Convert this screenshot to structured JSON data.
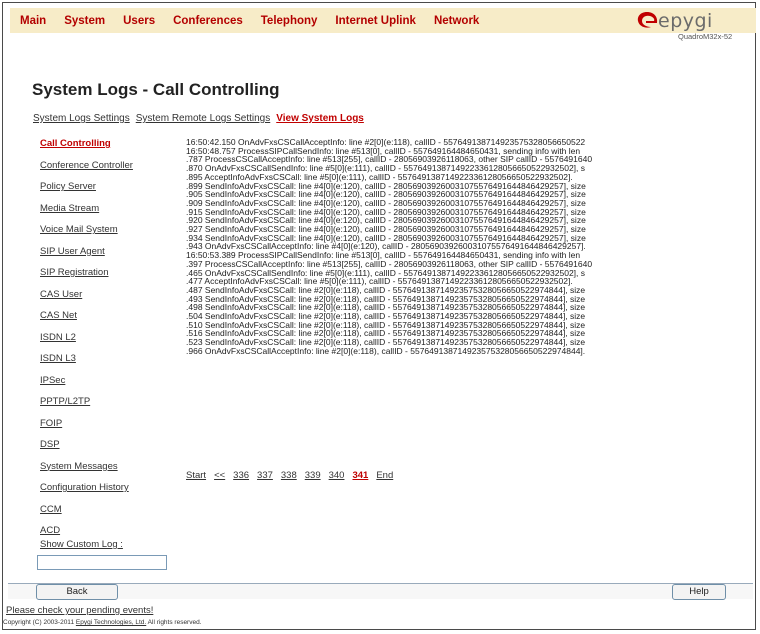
{
  "menu": [
    "Main",
    "System",
    "Users",
    "Conferences",
    "Telephony",
    "Internet Uplink",
    "Network"
  ],
  "logo": {
    "brand": "epygi",
    "model": "QuadroM32x-52"
  },
  "page_title": "System Logs - Call Controlling",
  "tabs": [
    {
      "label": "System Logs Settings",
      "active": false
    },
    {
      "label": "System Remote Logs Settings",
      "active": false
    },
    {
      "label": "View System Logs",
      "active": true
    }
  ],
  "sidebar": [
    {
      "label": "Call Controlling",
      "active": true
    },
    {
      "label": "Conference Controller",
      "active": false
    },
    {
      "label": "Policy Server",
      "active": false
    },
    {
      "label": "Media Stream",
      "active": false
    },
    {
      "label": "Voice Mail System",
      "active": false
    },
    {
      "label": "SIP User Agent",
      "active": false
    },
    {
      "label": "SIP Registration",
      "active": false
    },
    {
      "label": "CAS User",
      "active": false
    },
    {
      "label": "CAS Net",
      "active": false
    },
    {
      "label": "ISDN L2",
      "active": false
    },
    {
      "label": "ISDN L3",
      "active": false
    },
    {
      "label": "IPSec",
      "active": false
    },
    {
      "label": "PPTP/L2TP",
      "active": false
    },
    {
      "label": "FOIP",
      "active": false
    },
    {
      "label": "DSP",
      "active": false
    },
    {
      "label": "System Messages",
      "active": false
    },
    {
      "label": "Configuration History",
      "active": false
    },
    {
      "label": "CCM",
      "active": false
    },
    {
      "label": "ACD",
      "active": false
    }
  ],
  "custom_log": {
    "label": "Show Custom Log :",
    "value": ""
  },
  "log_lines": [
    "16:50:42.150 OnAdvFxsCSCallAcceptInfo: line #2[0](e:118), callID - 557649138714923575328056650522",
    "16:50:48.757 ProcessSIPCallSendInfo: line #513[0], callID - 557649164484650431, sending info with len",
    ".787 ProcessCSCallAcceptInfo: line #513[255], callID - 28056903926118063, other SIP callID - 5576491640",
    ".870 OnAdvFxsCSCallSendInfo: line #5[0](e:111), callID - 557649138714922336128056650522932502], s",
    ".895 AcceptInfoAdvFxsCSCall: line #5[0](e:111), callID - 557649138714922336128056650522932502].",
    ".899 SendInfoAdvFxsCSCall: line #4[0](e:120), callID - 280569039260031075576491644846429257], size",
    ".905 SendInfoAdvFxsCSCall: line #4[0](e:120), callID - 280569039260031075576491644846429257], size",
    ".909 SendInfoAdvFxsCSCall: line #4[0](e:120), callID - 280569039260031075576491644846429257], size",
    ".915 SendInfoAdvFxsCSCall: line #4[0](e:120), callID - 280569039260031075576491644846429257], size",
    ".920 SendInfoAdvFxsCSCall: line #4[0](e:120), callID - 280569039260031075576491644846429257], size",
    ".927 SendInfoAdvFxsCSCall: line #4[0](e:120), callID - 280569039260031075576491644846429257], size",
    ".934 SendInfoAdvFxsCSCall: line #4[0](e:120), callID - 280569039260031075576491644846429257], size",
    ".943 OnAdvFxsCSCallAcceptInfo: line #4[0](e:120), callID - 280569039260031075576491644846429257].",
    "16:50:53.389 ProcessSIPCallSendInfo: line #513[0], callID - 557649164484650431, sending info with len",
    ".397 ProcessCSCallAcceptInfo: line #513[255], callID - 28056903926118063, other SIP callID - 5576491640",
    ".465 OnAdvFxsCSCallSendInfo: line #5[0](e:111), callID - 557649138714922336128056650522932502], s",
    ".477 AcceptInfoAdvFxsCSCall: line #5[0](e:111), callID - 557649138714922336128056650522932502].",
    ".487 SendInfoAdvFxsCSCall: line #2[0](e:118), callID - 557649138714923575328056650522974844], size",
    ".493 SendInfoAdvFxsCSCall: line #2[0](e:118), callID - 557649138714923575328056650522974844], size",
    ".498 SendInfoAdvFxsCSCall: line #2[0](e:118), callID - 557649138714923575328056650522974844], size",
    ".504 SendInfoAdvFxsCSCall: line #2[0](e:118), callID - 557649138714923575328056650522974844], size",
    ".510 SendInfoAdvFxsCSCall: line #2[0](e:118), callID - 557649138714923575328056650522974844], size",
    ".516 SendInfoAdvFxsCSCall: line #2[0](e:118), callID - 557649138714923575328056650522974844], size",
    ".523 SendInfoAdvFxsCSCall: line #2[0](e:118), callID - 557649138714923575328056650522974844], size",
    ".966 OnAdvFxsCSCallAcceptInfo: line #2[0](e:118), callID - 557649138714923575328056650522974844]."
  ],
  "pager": [
    {
      "label": "Start",
      "current": false
    },
    {
      "label": "<<",
      "current": false
    },
    {
      "label": "336",
      "current": false
    },
    {
      "label": "337",
      "current": false
    },
    {
      "label": "338",
      "current": false
    },
    {
      "label": "339",
      "current": false
    },
    {
      "label": "340",
      "current": false
    },
    {
      "label": "341",
      "current": true
    },
    {
      "label": "End",
      "current": false
    }
  ],
  "buttons": {
    "back": "Back",
    "help": "Help"
  },
  "footer": {
    "pending": "Please check your pending events!",
    "copyright_prefix": "Copyright (C) 2003-2011 ",
    "copyright_link": "Epygi Technologies, Ltd.",
    "copyright_suffix": " All rights reserved."
  },
  "colors": {
    "accent_red": "#c00000",
    "menu_bg": "#f7ecc8"
  }
}
